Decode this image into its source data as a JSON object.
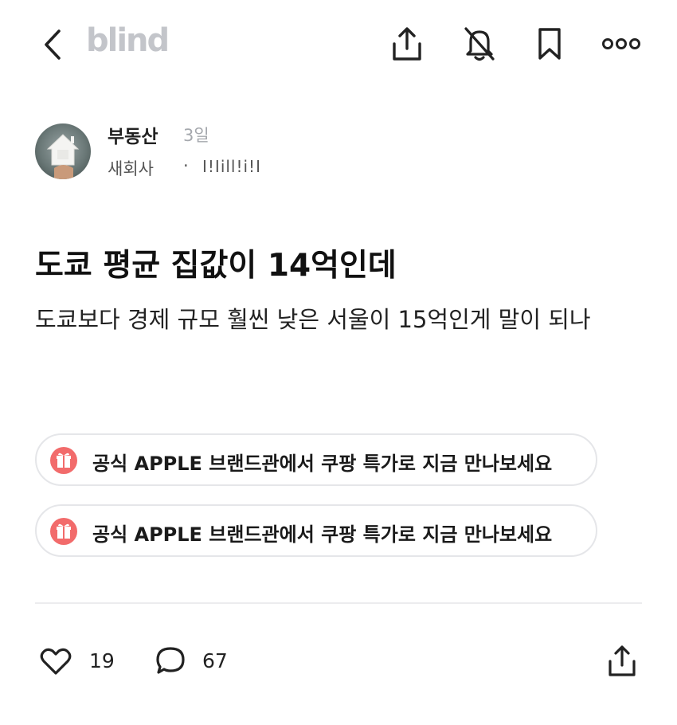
{
  "header": {
    "logo": "blind",
    "icons": [
      "back-icon",
      "share-icon",
      "notification-off-icon",
      "bookmark-icon",
      "more-icon"
    ]
  },
  "author": {
    "name": "부동산",
    "time": "3일",
    "company": "새회사",
    "separator": "·",
    "handle": "I!Iill!i!I"
  },
  "post": {
    "title": "도쿄 평균 집값이 14억인데",
    "body": "도쿄보다 경제 규모 훨씬 낮은 서울이 15억인게 말이 되나"
  },
  "promos": [
    {
      "text": "공식 APPLE 브랜드관에서 쿠팡 특가로 지금 만나보세요"
    },
    {
      "text": "공식 APPLE 브랜드관에서 쿠팡 특가로 지금 만나보세요"
    }
  ],
  "stats": {
    "likes": "19",
    "comments": "67"
  },
  "colors": {
    "logo": "#c3c5ca",
    "promo_icon": "#f26b6b",
    "divider": "#ececee"
  }
}
